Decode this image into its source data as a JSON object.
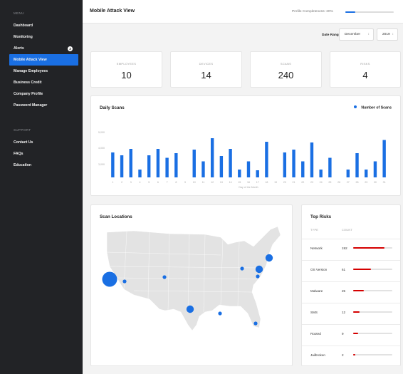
{
  "sidebar": {
    "section_menu": "MENU",
    "items": [
      {
        "label": "Dashboard"
      },
      {
        "label": "Monitoring"
      },
      {
        "label": "Alerts",
        "badge": "3"
      },
      {
        "label": "Mobile Attack View",
        "active": true
      },
      {
        "label": "Manage Employees"
      },
      {
        "label": "Business Credit"
      },
      {
        "label": "Company Profile"
      },
      {
        "label": "Password Manager"
      }
    ],
    "section_support": "SUPPORT",
    "support_items": [
      {
        "label": "Contact Us"
      },
      {
        "label": "FAQs"
      },
      {
        "label": "Education"
      }
    ]
  },
  "header": {
    "title": "Mobile Attack View",
    "profile_label": "Profile Completeness: 20%",
    "profile_progress": 0.2
  },
  "filters": {
    "date_range_label": "Date Range",
    "month": "December",
    "year": "2019"
  },
  "stats": [
    {
      "label": "EMPLOYEES",
      "value": "10"
    },
    {
      "label": "DEVICES",
      "value": "14"
    },
    {
      "label": "SCANS",
      "value": "240"
    },
    {
      "label": "RISKS",
      "value": "4"
    }
  ],
  "chart_data": {
    "type": "bar",
    "title": "Daily Scans",
    "legend_position": "top-right",
    "series": [
      {
        "name": "Number of Scans",
        "color": "#1a6fe3",
        "values": [
          7000,
          6200,
          8000,
          2200,
          6200,
          8000,
          5500,
          6800,
          0,
          7800,
          4500,
          11000,
          6000,
          8000,
          2200,
          4500,
          2000,
          10000,
          0,
          7000,
          7800,
          4500,
          9800,
          2200,
          5500,
          0,
          2200,
          6800,
          2200,
          4500,
          10500
        ]
      }
    ],
    "categories": [
      "1",
      "2",
      "3",
      "4",
      "5",
      "6",
      "7",
      "8",
      "9",
      "10",
      "11",
      "12",
      "13",
      "14",
      "15",
      "16",
      "17",
      "18",
      "19",
      "20",
      "21",
      "22",
      "23",
      "24",
      "25",
      "26",
      "27",
      "28",
      "29",
      "30",
      "31"
    ],
    "xlabel": "Day of the Month",
    "ylabel": "",
    "ylim": [
      0,
      12000
    ],
    "yticks": [
      "5,000",
      "4,000",
      "3,000"
    ],
    "grid": false
  },
  "map": {
    "title": "Scan Locations",
    "markers": [
      {
        "name": "los-angeles",
        "size": 3
      },
      {
        "name": "las-vegas",
        "size": 1
      },
      {
        "name": "denver",
        "size": 1
      },
      {
        "name": "dallas",
        "size": 2
      },
      {
        "name": "new-orleans",
        "size": 1
      },
      {
        "name": "chicago",
        "size": 1
      },
      {
        "name": "washington-dc",
        "size": 2
      },
      {
        "name": "new-york",
        "size": 2
      },
      {
        "name": "philadelphia",
        "size": 1
      },
      {
        "name": "miami",
        "size": 1
      }
    ],
    "marker_color": "#1a6fe3"
  },
  "risks": {
    "title": "Top Risks",
    "col_type": "TYPE",
    "col_count": "COUNT",
    "rows": [
      {
        "type": "Network",
        "count": "192",
        "fraction": 0.8
      },
      {
        "type": "OS Version",
        "count": "61",
        "fraction": 0.45
      },
      {
        "type": "Malware",
        "count": "25",
        "fraction": 0.28
      },
      {
        "type": "SMS",
        "count": "12",
        "fraction": 0.17
      },
      {
        "type": "Rooted",
        "count": "9",
        "fraction": 0.13
      },
      {
        "type": "Jailbroken",
        "count": "2",
        "fraction": 0.05
      }
    ],
    "bar_color": "#d50000"
  }
}
